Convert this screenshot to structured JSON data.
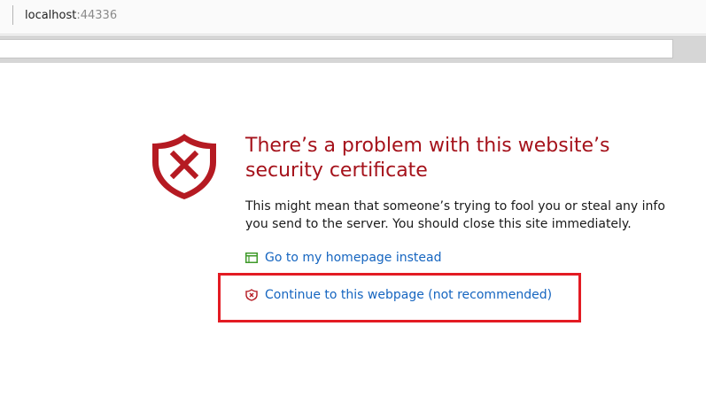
{
  "browser": {
    "url_host": "localhost",
    "url_port": ":44336"
  },
  "error_page": {
    "title": "There’s a problem with this website’s security certificate",
    "description": "This might mean that someone’s trying to fool you or steal any info you send to the server. You should close this site immediately.",
    "links": {
      "homepage": "Go to my homepage instead",
      "continue": "Continue to this webpage (not recommended)"
    }
  },
  "icons": {
    "warning": "shield-x-icon",
    "homepage": "browser-window-icon",
    "continue": "small-shield-x-icon"
  },
  "colors": {
    "title": "#a5121b",
    "shield": "#b51a22",
    "link": "#1565c0",
    "highlight_box": "#e31b23",
    "homepage_icon": "#3f9a2a"
  }
}
